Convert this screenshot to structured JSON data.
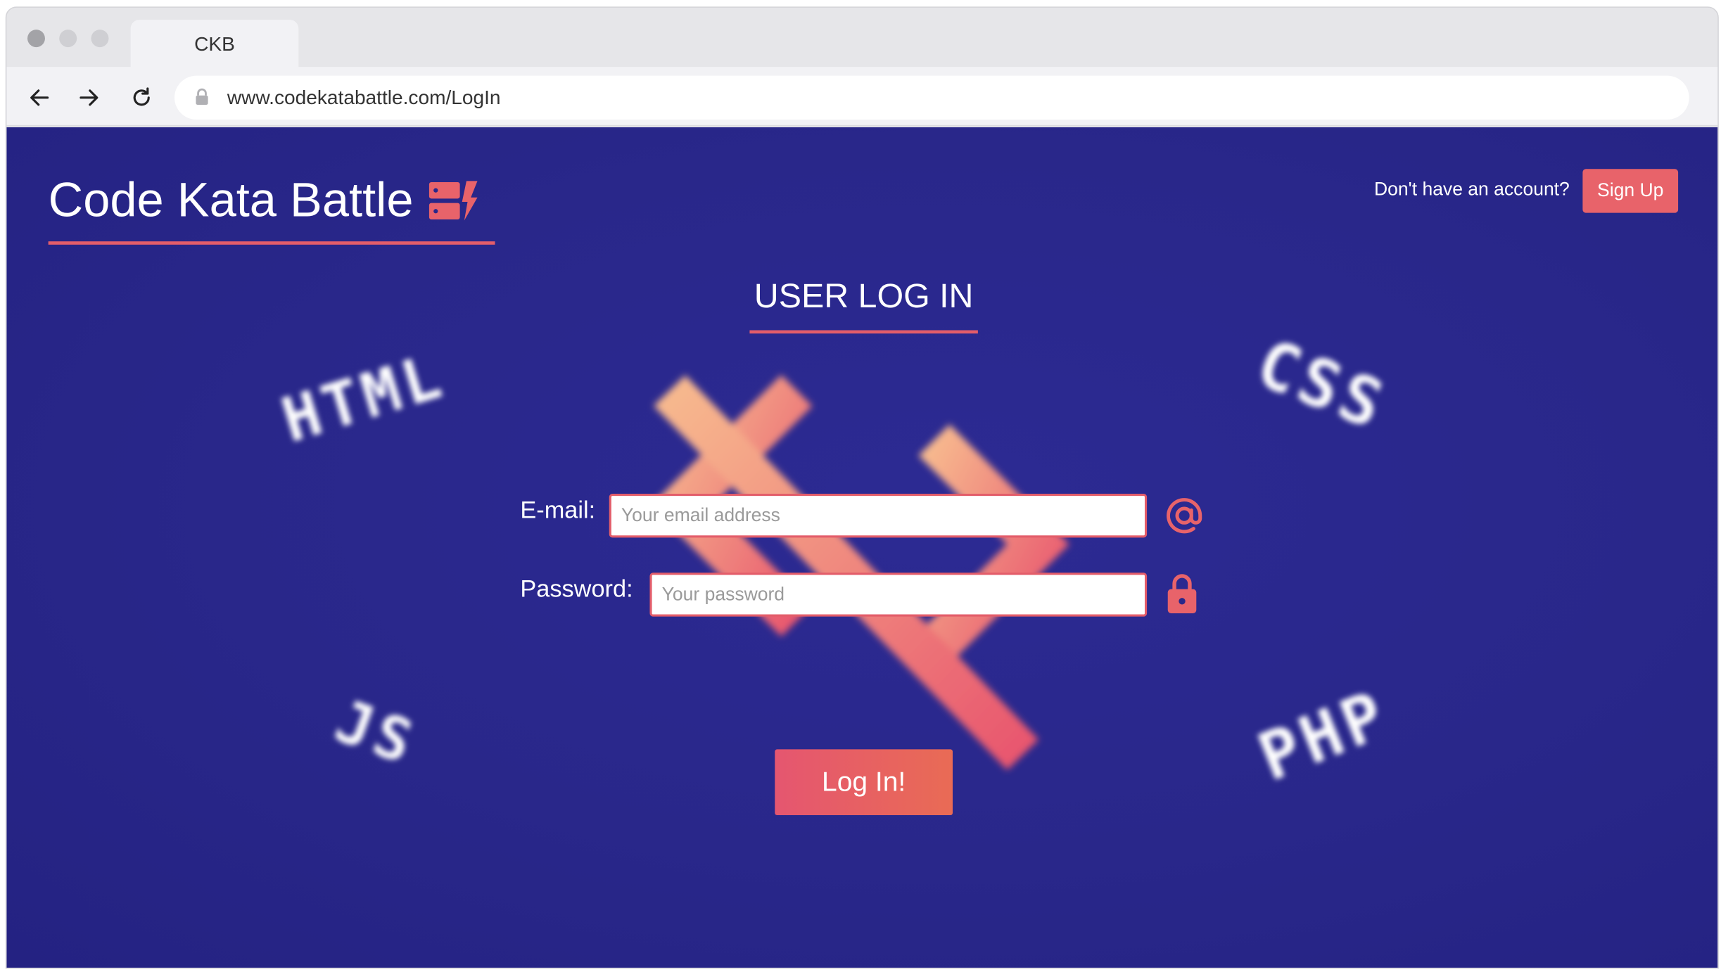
{
  "browser": {
    "tab_title": "CKB",
    "url": "www.codekatabattle.com/LogIn"
  },
  "header": {
    "logo_text": "Code Kata Battle",
    "account_prompt": "Don't have an account?",
    "signup_label": "Sign Up"
  },
  "form": {
    "title": "USER LOG IN",
    "email_label": "E-mail:",
    "email_placeholder": "Your email address",
    "password_label": "Password:",
    "password_placeholder": "Your password",
    "submit_label": "Log In!"
  },
  "decorations": {
    "word_1": "HTML",
    "word_2": "CSS",
    "word_3": "JS",
    "word_4": "PHP"
  },
  "icons": {
    "back": "arrow-left-icon",
    "forward": "arrow-right-icon",
    "reload": "reload-icon",
    "url_lock": "lock-icon",
    "logo": "ckb-logo-icon",
    "email": "at-sign-icon",
    "password": "padlock-icon"
  },
  "colors": {
    "page_background": "#29278a",
    "accent": "#e35d6a",
    "button_gradient_start": "#e55670",
    "button_gradient_end": "#e96b55",
    "text": "#ffffff"
  }
}
